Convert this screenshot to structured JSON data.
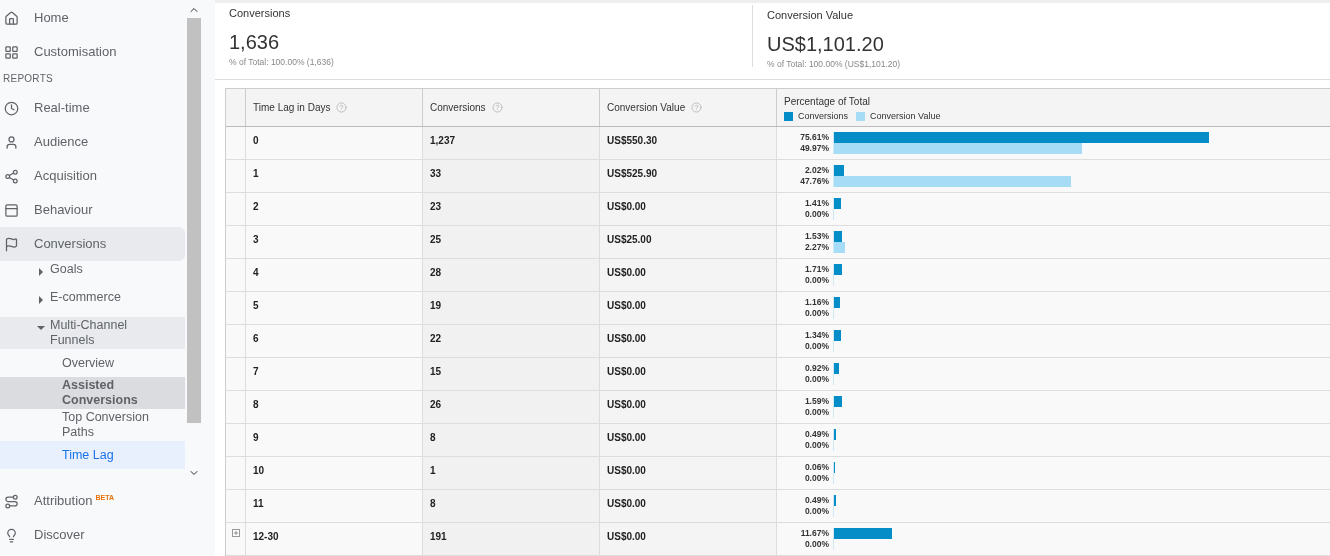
{
  "sidebar": {
    "top_items": [
      {
        "label": "Home"
      },
      {
        "label": "Customisation"
      }
    ],
    "section_label": "REPORTS",
    "report_items": [
      {
        "label": "Real-time",
        "expanded": false
      },
      {
        "label": "Audience",
        "expanded": false
      },
      {
        "label": "Acquisition",
        "expanded": false
      },
      {
        "label": "Behaviour",
        "expanded": false
      },
      {
        "label": "Conversions",
        "expanded": true,
        "children": [
          {
            "label": "Goals",
            "expanded": false
          },
          {
            "label": "E-commerce",
            "expanded": false
          },
          {
            "label": "Multi-Channel Funnels",
            "expanded": true,
            "children": [
              {
                "label": "Overview",
                "selected": false,
                "hovered": false
              },
              {
                "label": "Assisted Conversions",
                "selected": false,
                "hovered": true
              },
              {
                "label": "Top Conversion Paths",
                "selected": false,
                "hovered": false
              },
              {
                "label": "Time Lag",
                "selected": true,
                "hovered": false
              }
            ]
          }
        ]
      }
    ],
    "bottom_items": [
      {
        "label": "Attribution",
        "badge": "BETA"
      },
      {
        "label": "Discover"
      }
    ]
  },
  "summary": [
    {
      "label": "Conversions",
      "value": "1,636",
      "total": "% of Total: 100.00% (1,636)"
    },
    {
      "label": "Conversion Value",
      "value": "US$1,101.20",
      "total": "% of Total: 100.00% (US$1,101.20)"
    }
  ],
  "table": {
    "columns": [
      "Time Lag in Days",
      "Conversions",
      "Conversion Value"
    ],
    "chart_header": {
      "title": "Percentage of Total",
      "legend": [
        {
          "label": "Conversions",
          "color": "#058dc7"
        },
        {
          "label": "Conversion Value",
          "color": "#a6dcf5"
        }
      ]
    },
    "rows": [
      {
        "lag": "0",
        "conversions": "1,237",
        "value": "US$550.30",
        "expandable": false,
        "conv_share": {
          "level": 0.7561,
          "reading": "75.61%"
        },
        "value_share": {
          "level": 0.4997,
          "reading": "49.97%"
        }
      },
      {
        "lag": "1",
        "conversions": "33",
        "value": "US$525.90",
        "expandable": false,
        "conv_share": {
          "level": 0.0202,
          "reading": "2.02%"
        },
        "value_share": {
          "level": 0.4776,
          "reading": "47.76%"
        }
      },
      {
        "lag": "2",
        "conversions": "23",
        "value": "US$0.00",
        "expandable": false,
        "conv_share": {
          "level": 0.0141,
          "reading": "1.41%"
        },
        "value_share": {
          "level": 0,
          "reading": "0.00%"
        }
      },
      {
        "lag": "3",
        "conversions": "25",
        "value": "US$25.00",
        "expandable": false,
        "conv_share": {
          "level": 0.0153,
          "reading": "1.53%"
        },
        "value_share": {
          "level": 0.0227,
          "reading": "2.27%"
        }
      },
      {
        "lag": "4",
        "conversions": "28",
        "value": "US$0.00",
        "expandable": false,
        "conv_share": {
          "level": 0.0171,
          "reading": "1.71%"
        },
        "value_share": {
          "level": 0,
          "reading": "0.00%"
        }
      },
      {
        "lag": "5",
        "conversions": "19",
        "value": "US$0.00",
        "expandable": false,
        "conv_share": {
          "level": 0.0116,
          "reading": "1.16%"
        },
        "value_share": {
          "level": 0,
          "reading": "0.00%"
        }
      },
      {
        "lag": "6",
        "conversions": "22",
        "value": "US$0.00",
        "expandable": false,
        "conv_share": {
          "level": 0.0134,
          "reading": "1.34%"
        },
        "value_share": {
          "level": 0,
          "reading": "0.00%"
        }
      },
      {
        "lag": "7",
        "conversions": "15",
        "value": "US$0.00",
        "expandable": false,
        "conv_share": {
          "level": 0.0092,
          "reading": "0.92%"
        },
        "value_share": {
          "level": 0,
          "reading": "0.00%"
        }
      },
      {
        "lag": "8",
        "conversions": "26",
        "value": "US$0.00",
        "expandable": false,
        "conv_share": {
          "level": 0.0159,
          "reading": "1.59%"
        },
        "value_share": {
          "level": 0,
          "reading": "0.00%"
        }
      },
      {
        "lag": "9",
        "conversions": "8",
        "value": "US$0.00",
        "expandable": false,
        "conv_share": {
          "level": 0.0049,
          "reading": "0.49%"
        },
        "value_share": {
          "level": 0,
          "reading": "0.00%"
        }
      },
      {
        "lag": "10",
        "conversions": "1",
        "value": "US$0.00",
        "expandable": false,
        "conv_share": {
          "level": 0.0006,
          "reading": "0.06%"
        },
        "value_share": {
          "level": 0,
          "reading": "0.00%"
        }
      },
      {
        "lag": "11",
        "conversions": "8",
        "value": "US$0.00",
        "expandable": false,
        "conv_share": {
          "level": 0.0049,
          "reading": "0.49%"
        },
        "value_share": {
          "level": 0,
          "reading": "0.00%"
        }
      },
      {
        "lag": "12-30",
        "conversions": "191",
        "value": "US$0.00",
        "expandable": true,
        "conv_share": {
          "level": 0.1167,
          "reading": "11.67%"
        },
        "value_share": {
          "level": 0,
          "reading": "0.00%"
        }
      }
    ]
  }
}
